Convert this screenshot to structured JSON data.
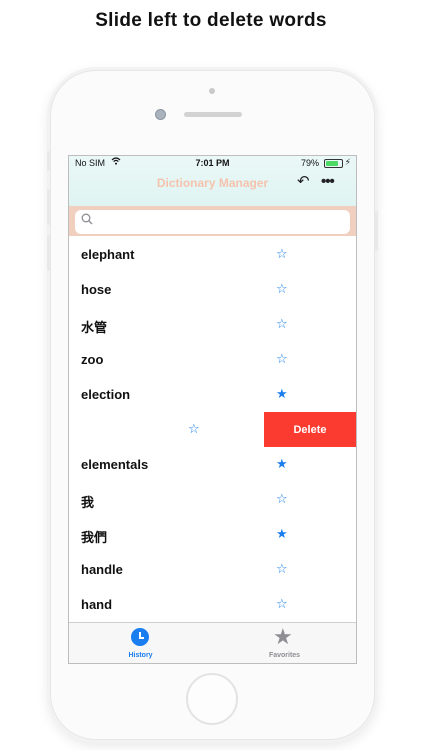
{
  "caption": "Slide left to delete words",
  "status_bar": {
    "carrier": "No SIM",
    "wifi_icon": "wifi-icon",
    "time": "7:01 PM",
    "battery_percent": "79%",
    "battery_level": 0.79
  },
  "nav": {
    "title": "Dictionary Manager",
    "undo_icon": "↶",
    "more_icon": "•••"
  },
  "search": {
    "placeholder": "",
    "value": ""
  },
  "colors": {
    "accent": "#1a7ef0",
    "delete": "#fb3b30",
    "title": "#f5c2ad",
    "search_bg": "#f0cfbf",
    "header_bg": "#dff4f2"
  },
  "rows": [
    {
      "word": "elephant",
      "favorite": false
    },
    {
      "word": "hose",
      "favorite": false
    },
    {
      "word": "水管",
      "favorite": false
    },
    {
      "word": "zoo",
      "favorite": false
    },
    {
      "word": "election",
      "favorite": true
    },
    {
      "word": "",
      "favorite": false,
      "swiped": true,
      "delete_label": "Delete"
    },
    {
      "word": "elementals",
      "favorite": true
    },
    {
      "word": "我",
      "favorite": false
    },
    {
      "word": "我們",
      "favorite": true
    },
    {
      "word": "handle",
      "favorite": false
    },
    {
      "word": "hand",
      "favorite": false
    }
  ],
  "tabs": [
    {
      "label": "History",
      "icon": "clock-icon",
      "selected": true
    },
    {
      "label": "Favorites",
      "icon": "star-icon",
      "selected": false
    }
  ]
}
